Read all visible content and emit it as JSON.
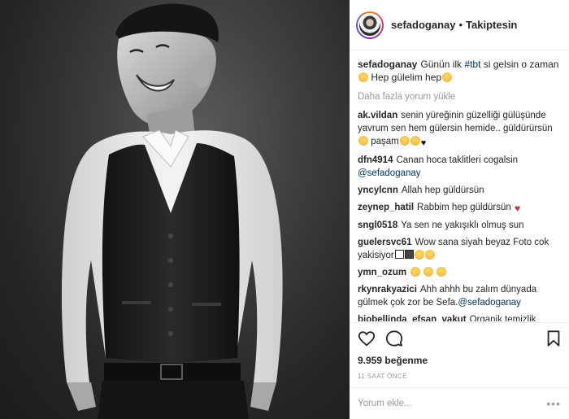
{
  "header": {
    "username": "sefadoganay",
    "separator": "•",
    "follow_status": "Takiptesin"
  },
  "caption": {
    "username": "sefadoganay",
    "text_before_tag": "Günün ilk ",
    "hashtag": "#tbt",
    "text_after_tag": " si gelsin o zaman",
    "text_end": " Hep gülelim hep"
  },
  "load_more": "Daha fazla yorum yükle",
  "comments": [
    {
      "username": "ak.vildan",
      "text": "senin yüreğinin güzelliği gülüşünde yavrum sen hem gülersin hemide.. güldürürsün",
      "text2": " paşam"
    },
    {
      "username": "dfn4914",
      "text": "Canan hoca taklitleri cogalsin ",
      "mention": "@sefadoganay"
    },
    {
      "username": "yncylcnn",
      "text": "Allah hep güldürsün"
    },
    {
      "username": "zeynep_hatil",
      "text": "Rabbim hep güldürsün"
    },
    {
      "username": "sngl0518",
      "text": "Ya sen ne yakışıklı olmuş sun"
    },
    {
      "username": "guelersvc61",
      "text": "Wow sana siyah beyaz Foto cok yakisiyor"
    },
    {
      "username": "ymn_ozum",
      "text": ""
    },
    {
      "username": "rkynrakyazici",
      "text": "Ahh ahhh bu zalım dünyada gülmek çok zor be Sefa.",
      "mention": "@sefadoganay"
    },
    {
      "username": "biobellinda_efsan_vakut",
      "text": "Organik temizlik"
    }
  ],
  "likes": {
    "count": "9.959",
    "label": "beğenme"
  },
  "time_ago": "11 SAAT ÖNCE",
  "add_comment": {
    "placeholder": "Yorum ekle...",
    "more": "•••"
  },
  "icons": {
    "like": "heart-icon",
    "comment": "comment-bubble-icon",
    "save": "bookmark-icon",
    "more": "more-dots-icon"
  },
  "colors": {
    "hashtag": "#003569",
    "muted": "#999999",
    "text": "#262626",
    "border": "#efefef"
  }
}
